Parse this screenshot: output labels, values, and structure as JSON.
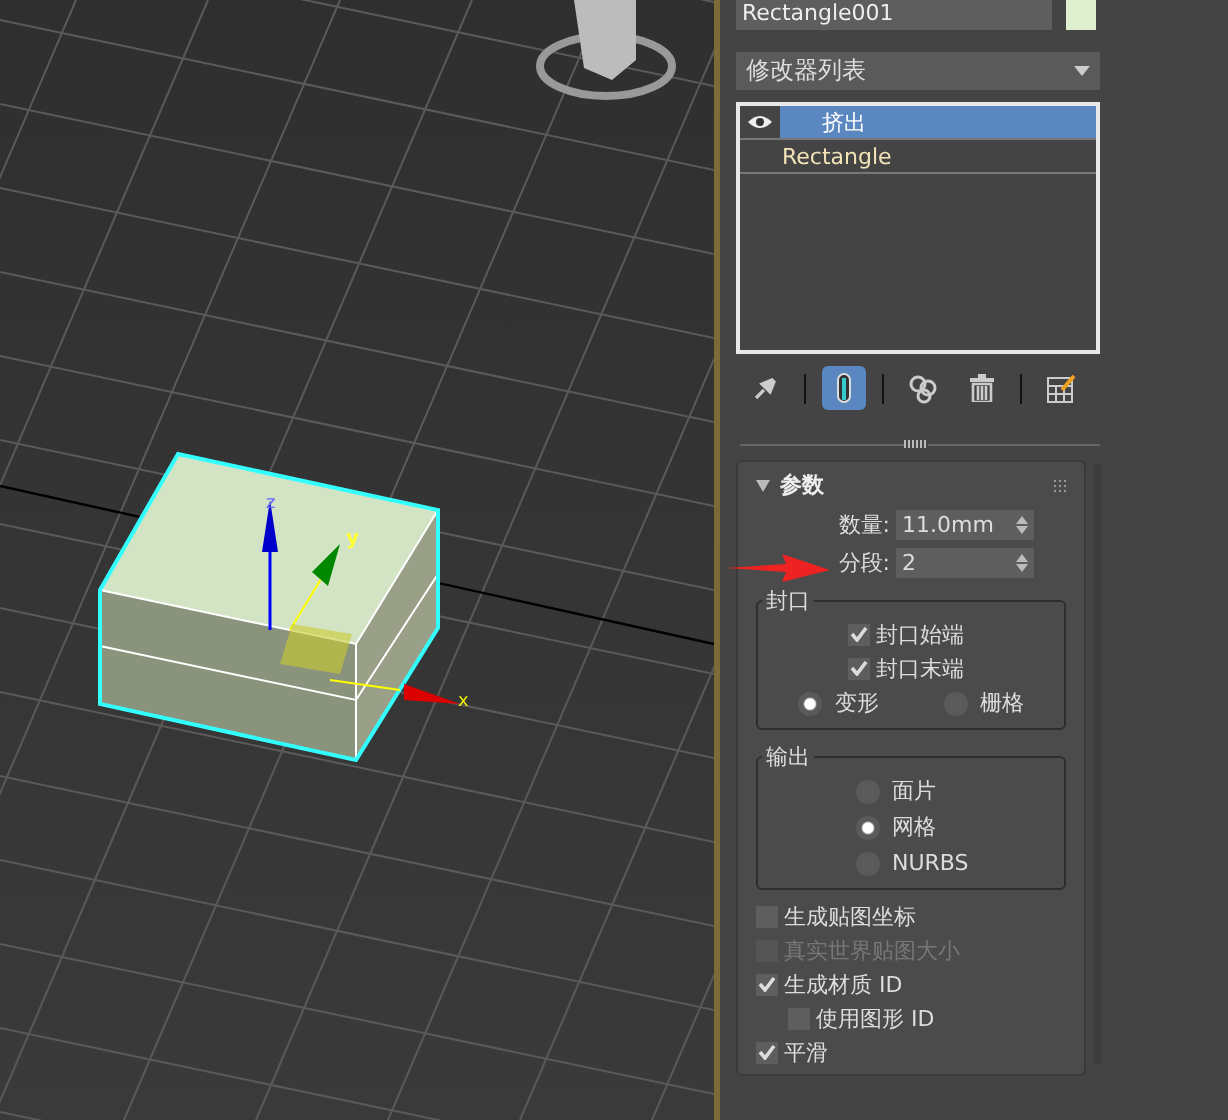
{
  "viewport": {
    "gizmo": {
      "z_label": "z",
      "y_label": "y",
      "x_label": "x"
    }
  },
  "object": {
    "name": "Rectangle001",
    "color": "#dff0d0"
  },
  "modifier_list": {
    "value": "修改器列表"
  },
  "stack": [
    {
      "label": "挤出",
      "selected": true,
      "eye": true
    },
    {
      "label": "Rectangle",
      "selected": false,
      "eye": false
    }
  ],
  "toolbar": [
    {
      "kind": "pin",
      "selected": false
    },
    {
      "kind": "separator"
    },
    {
      "kind": "show-end-result",
      "selected": true
    },
    {
      "kind": "separator"
    },
    {
      "kind": "make-unique",
      "selected": false
    },
    {
      "kind": "remove",
      "selected": false
    },
    {
      "kind": "separator"
    },
    {
      "kind": "configure",
      "selected": false
    }
  ],
  "rollout": {
    "title": "参数",
    "expanded": true,
    "fields": [
      {
        "label": "数量:",
        "value": "11.0mm"
      },
      {
        "label": "分段:",
        "value": "2"
      }
    ],
    "cap_group": {
      "title": "封口",
      "checks": [
        {
          "label": "封口始端",
          "checked": true
        },
        {
          "label": "封口末端",
          "checked": true
        }
      ],
      "radios": [
        {
          "label": "变形",
          "selected": true
        },
        {
          "label": "栅格",
          "selected": false
        }
      ]
    },
    "output_group": {
      "title": "输出",
      "radios": [
        {
          "label": "面片",
          "selected": false
        },
        {
          "label": "网格",
          "selected": true
        },
        {
          "label": "NURBS",
          "selected": false
        }
      ]
    },
    "options": [
      {
        "label": "生成贴图坐标",
        "checked": false,
        "disabled": false
      },
      {
        "label": "真实世界贴图大小",
        "checked": false,
        "disabled": true
      },
      {
        "label": "生成材质 ID",
        "checked": true,
        "disabled": false,
        "children": [
          {
            "label": "使用图形 ID",
            "checked": false,
            "disabled": false
          }
        ]
      },
      {
        "label": "平滑",
        "checked": true,
        "disabled": false
      }
    ]
  }
}
